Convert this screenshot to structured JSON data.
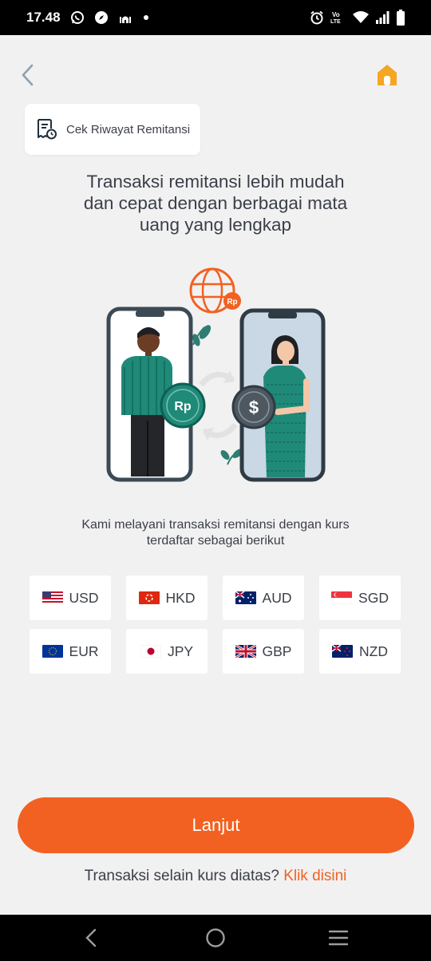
{
  "status_bar": {
    "time": "17.48",
    "notification_icons": [
      "whatsapp-icon",
      "compass-icon",
      "mosque-icon",
      "dot-icon"
    ],
    "system_icons": [
      "alarm-icon",
      "volte-icon",
      "wifi-icon",
      "signal-icon",
      "battery-icon"
    ],
    "volte_label": "Vo\nLTE"
  },
  "header": {
    "back_icon": "chevron-left-icon",
    "home_icon": "home-icon",
    "accent_color": "#f5a623"
  },
  "history_card": {
    "label": "Cek Riwayat Remitansi",
    "icon": "receipt-clock-icon"
  },
  "headline": {
    "line1": "Transaksi remitansi lebih mudah",
    "line2": "dan cepat dengan berbagai mata",
    "line3": "uang yang lengkap"
  },
  "illustration": {
    "coin_left": "Rp",
    "coin_right": "$",
    "globe_badge": "Rp"
  },
  "subtext": {
    "line1": "Kami melayani transaksi remitansi dengan kurs",
    "line2": "terdaftar sebagai berikut"
  },
  "currencies": [
    {
      "code": "USD",
      "flag": "us-flag-icon"
    },
    {
      "code": "HKD",
      "flag": "hk-flag-icon"
    },
    {
      "code": "AUD",
      "flag": "au-flag-icon"
    },
    {
      "code": "SGD",
      "flag": "sg-flag-icon"
    },
    {
      "code": "EUR",
      "flag": "eu-flag-icon"
    },
    {
      "code": "JPY",
      "flag": "jp-flag-icon"
    },
    {
      "code": "GBP",
      "flag": "gb-flag-icon"
    },
    {
      "code": "NZD",
      "flag": "nz-flag-icon"
    }
  ],
  "primary_button": {
    "label": "Lanjut",
    "color": "#f26122"
  },
  "footer": {
    "text": "Transaksi selain kurs diatas?",
    "link": "Klik disini"
  },
  "nav_bar": {
    "buttons": [
      "back-icon",
      "home-circle-icon",
      "menu-icon"
    ]
  }
}
